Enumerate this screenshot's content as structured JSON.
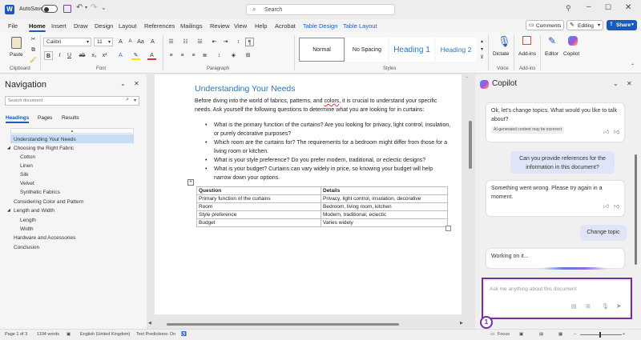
{
  "titlebar": {
    "autosave_label": "AutoSave",
    "search_placeholder": "Search"
  },
  "tabs": [
    "File",
    "Home",
    "Insert",
    "Draw",
    "Design",
    "Layout",
    "References",
    "Mailings",
    "Review",
    "View",
    "Help",
    "Acrobat",
    "Table Design",
    "Table Layout"
  ],
  "tab_right": {
    "comments": "Comments",
    "editing": "Editing",
    "share": "Share"
  },
  "ribbon": {
    "paste": "Paste",
    "font_name": "Calibri",
    "font_size": "11",
    "clipboard": "Clipboard",
    "font": "Font",
    "paragraph": "Paragraph",
    "styles": "Styles",
    "voice": "Voice",
    "addins_group": "Add-ins",
    "style_normal": "Normal",
    "style_nospacing": "No Spacing",
    "style_h1": "Heading 1",
    "style_h2": "Heading 2",
    "dictate": "Dictate",
    "addins": "Add-ins",
    "editor": "Editor",
    "copilot": "Copilot"
  },
  "nav": {
    "title": "Navigation",
    "search_placeholder": "Search document",
    "tabs": [
      "Headings",
      "Pages",
      "Results"
    ],
    "items": [
      "Understanding Your Needs",
      "Choosing the Right Fabric",
      "Cotton",
      "Linen",
      "Silk",
      "Velvet",
      "Synthetic Fabrics",
      "Considering Color and Pattern",
      "Length and Width",
      "Length",
      "Width",
      "Hardware and Accessories",
      "Conclusion"
    ]
  },
  "doc": {
    "heading": "Understanding Your Needs",
    "intro_1": "Before diving into the world of fabrics, patterns, and",
    "intro_colors": "colors",
    "intro_2": ", it is crucial to understand your specific needs. Ask yourself the following questions to determine what you are looking for in curtains:",
    "bullets": [
      "What is the primary function of the curtains? Are you looking for privacy, light control, insulation, or purely decorative purposes?",
      "Which room are the curtains for? The requirements for a bedroom might differ from those for a living room or kitchen.",
      "What is your style preference? Do you prefer modern, traditional, or eclectic designs?",
      "What is your budget? Curtains can vary widely in price, so knowing your budget will help narrow down your options."
    ],
    "table_header": [
      "Question",
      "Details"
    ],
    "table_rows": [
      [
        "Primary function of the curtains",
        "Privacy, light control, insulation, decorative"
      ],
      [
        "Room",
        "Bedroom, living room, kitchen"
      ],
      [
        "Style preference",
        "Modern, traditional, eclectic"
      ],
      [
        "Budget",
        "Varies widely"
      ]
    ]
  },
  "copilot": {
    "title": "Copilot",
    "msg1": "Ok, let's change topics. What would you like to talk about?",
    "ai_notice": "AI-generated content may be incorrect",
    "user1": "Can you provide references for the information in this document?",
    "msg2": "Something went wrong. Please try again in a moment.",
    "user2": "Change topic",
    "msg3": "Working on it...",
    "input_placeholder": "Ask me anything about this document"
  },
  "status": {
    "page": "Page 1 of 3",
    "words": "1104 words",
    "language": "English (United Kingdom)",
    "predictions": "Text Predictions: On",
    "focus": "Focus"
  },
  "colors": {
    "accent": "#185abd",
    "heading": "#2e74b5",
    "highlight": "#7030a0"
  }
}
